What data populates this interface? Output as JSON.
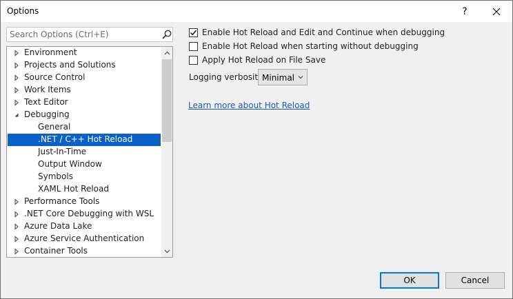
{
  "window": {
    "title": "Options",
    "help_glyph": "?",
    "close_glyph": "✕"
  },
  "search": {
    "placeholder": "Search Options (Ctrl+E)",
    "icon": "search-icon"
  },
  "tree": {
    "items": [
      {
        "label": "Environment",
        "expander": "collapsed",
        "level": 0
      },
      {
        "label": "Projects and Solutions",
        "expander": "collapsed",
        "level": 0
      },
      {
        "label": "Source Control",
        "expander": "collapsed",
        "level": 0
      },
      {
        "label": "Work Items",
        "expander": "collapsed",
        "level": 0
      },
      {
        "label": "Text Editor",
        "expander": "collapsed",
        "level": 0
      },
      {
        "label": "Debugging",
        "expander": "expanded",
        "level": 0
      },
      {
        "label": "General",
        "expander": "none",
        "level": 1
      },
      {
        "label": ".NET / C++ Hot Reload",
        "expander": "none",
        "level": 1,
        "selected": true
      },
      {
        "label": "Just-In-Time",
        "expander": "none",
        "level": 1
      },
      {
        "label": "Output Window",
        "expander": "none",
        "level": 1
      },
      {
        "label": "Symbols",
        "expander": "none",
        "level": 1
      },
      {
        "label": "XAML Hot Reload",
        "expander": "none",
        "level": 1
      },
      {
        "label": "Performance Tools",
        "expander": "collapsed",
        "level": 0
      },
      {
        "label": ".NET Core Debugging with WSL",
        "expander": "collapsed",
        "level": 0
      },
      {
        "label": "Azure Data Lake",
        "expander": "collapsed",
        "level": 0
      },
      {
        "label": "Azure Service Authentication",
        "expander": "collapsed",
        "level": 0
      },
      {
        "label": "Container Tools",
        "expander": "collapsed",
        "level": 0
      }
    ]
  },
  "options": {
    "enable_hot_reload": {
      "label": "Enable Hot Reload and Edit and Continue when debugging",
      "checked": true
    },
    "enable_without_debugging": {
      "label": "Enable Hot Reload when starting without debugging",
      "checked": false
    },
    "apply_on_save": {
      "label": "Apply Hot Reload on File Save",
      "checked": false
    },
    "logging_verbosity": {
      "label": "Logging verbosity",
      "value": "Minimal"
    },
    "learn_more_link": "Learn more about Hot Reload"
  },
  "buttons": {
    "ok": "OK",
    "cancel": "Cancel"
  },
  "colors": {
    "selection": "#0b60c6",
    "link": "#1a59b8",
    "default_button_border": "#0078d7"
  }
}
